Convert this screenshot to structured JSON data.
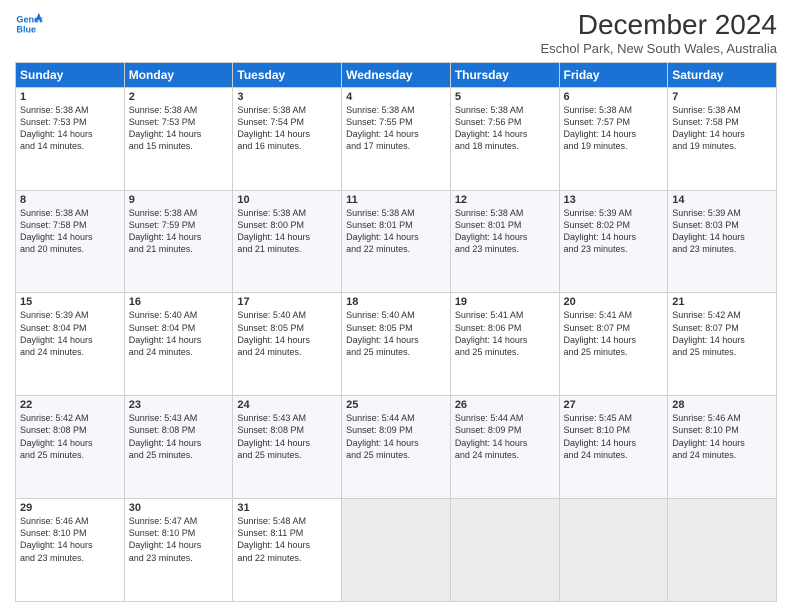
{
  "logo": {
    "line1": "General",
    "line2": "Blue"
  },
  "title": "December 2024",
  "subtitle": "Eschol Park, New South Wales, Australia",
  "header_days": [
    "Sunday",
    "Monday",
    "Tuesday",
    "Wednesday",
    "Thursday",
    "Friday",
    "Saturday"
  ],
  "weeks": [
    [
      {
        "day": "1",
        "lines": [
          "Sunrise: 5:38 AM",
          "Sunset: 7:53 PM",
          "Daylight: 14 hours",
          "and 14 minutes."
        ]
      },
      {
        "day": "2",
        "lines": [
          "Sunrise: 5:38 AM",
          "Sunset: 7:53 PM",
          "Daylight: 14 hours",
          "and 15 minutes."
        ]
      },
      {
        "day": "3",
        "lines": [
          "Sunrise: 5:38 AM",
          "Sunset: 7:54 PM",
          "Daylight: 14 hours",
          "and 16 minutes."
        ]
      },
      {
        "day": "4",
        "lines": [
          "Sunrise: 5:38 AM",
          "Sunset: 7:55 PM",
          "Daylight: 14 hours",
          "and 17 minutes."
        ]
      },
      {
        "day": "5",
        "lines": [
          "Sunrise: 5:38 AM",
          "Sunset: 7:56 PM",
          "Daylight: 14 hours",
          "and 18 minutes."
        ]
      },
      {
        "day": "6",
        "lines": [
          "Sunrise: 5:38 AM",
          "Sunset: 7:57 PM",
          "Daylight: 14 hours",
          "and 19 minutes."
        ]
      },
      {
        "day": "7",
        "lines": [
          "Sunrise: 5:38 AM",
          "Sunset: 7:58 PM",
          "Daylight: 14 hours",
          "and 19 minutes."
        ]
      }
    ],
    [
      {
        "day": "8",
        "lines": [
          "Sunrise: 5:38 AM",
          "Sunset: 7:58 PM",
          "Daylight: 14 hours",
          "and 20 minutes."
        ]
      },
      {
        "day": "9",
        "lines": [
          "Sunrise: 5:38 AM",
          "Sunset: 7:59 PM",
          "Daylight: 14 hours",
          "and 21 minutes."
        ]
      },
      {
        "day": "10",
        "lines": [
          "Sunrise: 5:38 AM",
          "Sunset: 8:00 PM",
          "Daylight: 14 hours",
          "and 21 minutes."
        ]
      },
      {
        "day": "11",
        "lines": [
          "Sunrise: 5:38 AM",
          "Sunset: 8:01 PM",
          "Daylight: 14 hours",
          "and 22 minutes."
        ]
      },
      {
        "day": "12",
        "lines": [
          "Sunrise: 5:38 AM",
          "Sunset: 8:01 PM",
          "Daylight: 14 hours",
          "and 23 minutes."
        ]
      },
      {
        "day": "13",
        "lines": [
          "Sunrise: 5:39 AM",
          "Sunset: 8:02 PM",
          "Daylight: 14 hours",
          "and 23 minutes."
        ]
      },
      {
        "day": "14",
        "lines": [
          "Sunrise: 5:39 AM",
          "Sunset: 8:03 PM",
          "Daylight: 14 hours",
          "and 23 minutes."
        ]
      }
    ],
    [
      {
        "day": "15",
        "lines": [
          "Sunrise: 5:39 AM",
          "Sunset: 8:04 PM",
          "Daylight: 14 hours",
          "and 24 minutes."
        ]
      },
      {
        "day": "16",
        "lines": [
          "Sunrise: 5:40 AM",
          "Sunset: 8:04 PM",
          "Daylight: 14 hours",
          "and 24 minutes."
        ]
      },
      {
        "day": "17",
        "lines": [
          "Sunrise: 5:40 AM",
          "Sunset: 8:05 PM",
          "Daylight: 14 hours",
          "and 24 minutes."
        ]
      },
      {
        "day": "18",
        "lines": [
          "Sunrise: 5:40 AM",
          "Sunset: 8:05 PM",
          "Daylight: 14 hours",
          "and 25 minutes."
        ]
      },
      {
        "day": "19",
        "lines": [
          "Sunrise: 5:41 AM",
          "Sunset: 8:06 PM",
          "Daylight: 14 hours",
          "and 25 minutes."
        ]
      },
      {
        "day": "20",
        "lines": [
          "Sunrise: 5:41 AM",
          "Sunset: 8:07 PM",
          "Daylight: 14 hours",
          "and 25 minutes."
        ]
      },
      {
        "day": "21",
        "lines": [
          "Sunrise: 5:42 AM",
          "Sunset: 8:07 PM",
          "Daylight: 14 hours",
          "and 25 minutes."
        ]
      }
    ],
    [
      {
        "day": "22",
        "lines": [
          "Sunrise: 5:42 AM",
          "Sunset: 8:08 PM",
          "Daylight: 14 hours",
          "and 25 minutes."
        ]
      },
      {
        "day": "23",
        "lines": [
          "Sunrise: 5:43 AM",
          "Sunset: 8:08 PM",
          "Daylight: 14 hours",
          "and 25 minutes."
        ]
      },
      {
        "day": "24",
        "lines": [
          "Sunrise: 5:43 AM",
          "Sunset: 8:08 PM",
          "Daylight: 14 hours",
          "and 25 minutes."
        ]
      },
      {
        "day": "25",
        "lines": [
          "Sunrise: 5:44 AM",
          "Sunset: 8:09 PM",
          "Daylight: 14 hours",
          "and 25 minutes."
        ]
      },
      {
        "day": "26",
        "lines": [
          "Sunrise: 5:44 AM",
          "Sunset: 8:09 PM",
          "Daylight: 14 hours",
          "and 24 minutes."
        ]
      },
      {
        "day": "27",
        "lines": [
          "Sunrise: 5:45 AM",
          "Sunset: 8:10 PM",
          "Daylight: 14 hours",
          "and 24 minutes."
        ]
      },
      {
        "day": "28",
        "lines": [
          "Sunrise: 5:46 AM",
          "Sunset: 8:10 PM",
          "Daylight: 14 hours",
          "and 24 minutes."
        ]
      }
    ],
    [
      {
        "day": "29",
        "lines": [
          "Sunrise: 5:46 AM",
          "Sunset: 8:10 PM",
          "Daylight: 14 hours",
          "and 23 minutes."
        ]
      },
      {
        "day": "30",
        "lines": [
          "Sunrise: 5:47 AM",
          "Sunset: 8:10 PM",
          "Daylight: 14 hours",
          "and 23 minutes."
        ]
      },
      {
        "day": "31",
        "lines": [
          "Sunrise: 5:48 AM",
          "Sunset: 8:11 PM",
          "Daylight: 14 hours",
          "and 22 minutes."
        ]
      },
      {
        "day": "",
        "lines": []
      },
      {
        "day": "",
        "lines": []
      },
      {
        "day": "",
        "lines": []
      },
      {
        "day": "",
        "lines": []
      }
    ]
  ]
}
